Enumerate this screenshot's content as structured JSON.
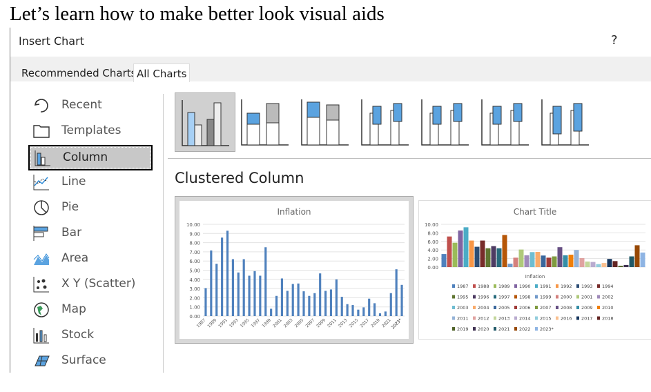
{
  "slide": {
    "title": "Let’s learn how to make better look visual aids"
  },
  "dialog": {
    "title": "Insert Chart",
    "help": "?",
    "tabs": [
      {
        "label": "Recommended Charts"
      },
      {
        "label": "All Charts"
      }
    ],
    "nav": [
      {
        "label": "Recent",
        "icon": "recent-icon"
      },
      {
        "label": "Templates",
        "icon": "folder-icon"
      },
      {
        "label": "Column",
        "icon": "column-chart-icon",
        "selected": true
      },
      {
        "label": "Line",
        "icon": "line-chart-icon"
      },
      {
        "label": "Pie",
        "icon": "pie-chart-icon"
      },
      {
        "label": "Bar",
        "icon": "bar-chart-icon"
      },
      {
        "label": "Area",
        "icon": "area-chart-icon"
      },
      {
        "label": "X Y (Scatter)",
        "icon": "scatter-chart-icon"
      },
      {
        "label": "Map",
        "icon": "map-icon"
      },
      {
        "label": "Stock",
        "icon": "stock-chart-icon"
      },
      {
        "label": "Surface",
        "icon": "surface-chart-icon"
      }
    ],
    "chart_types": [
      "clustered-column",
      "stacked-column",
      "100-stacked-column",
      "3d-clustered-column",
      "3d-stacked-column",
      "3d-100-stacked-column",
      "3d-column"
    ],
    "selected_type_label": "Clustered Column"
  },
  "chart_data": [
    {
      "type": "bar",
      "title": "Inflation",
      "xlabel": "",
      "ylabel": "",
      "ylim": [
        0,
        10
      ],
      "yticks": [
        "0.00",
        "1.00",
        "2.00",
        "3.00",
        "4.00",
        "5.00",
        "6.00",
        "7.00",
        "8.00",
        "9.00",
        "10.00"
      ],
      "grid": true,
      "color": "#4f81bd",
      "categories": [
        "1987",
        "1988",
        "1989",
        "1990",
        "1991",
        "1992",
        "1993",
        "1994",
        "1995",
        "1996",
        "1997",
        "1998",
        "1999",
        "2000",
        "2001",
        "2002",
        "2003",
        "2004",
        "2005",
        "2006",
        "2007",
        "2008",
        "2009",
        "2010",
        "2011",
        "2012",
        "2013",
        "2014",
        "2015",
        "2016",
        "2017",
        "2018",
        "2019",
        "2020",
        "2021",
        "2022",
        "2023*"
      ],
      "values": [
        3.05,
        7.15,
        5.7,
        8.55,
        9.3,
        6.2,
        4.75,
        6.2,
        4.4,
        4.9,
        4.4,
        7.5,
        0.8,
        2.2,
        4.1,
        2.75,
        3.5,
        3.55,
        2.7,
        2.2,
        2.5,
        4.65,
        2.75,
        2.9,
        4.0,
        2.1,
        1.3,
        1.2,
        0.7,
        0.95,
        1.9,
        1.4,
        0.3,
        0.5,
        2.5,
        5.1,
        3.4
      ]
    },
    {
      "type": "bar",
      "title": "Chart Title",
      "xlabel": "Inflation",
      "ylim": [
        0,
        10
      ],
      "yticks": [
        "0.00",
        "2.00",
        "4.00",
        "6.00",
        "8.00",
        "10.00"
      ],
      "grid": true,
      "legend": "bottom",
      "series_from": "categories of first chart",
      "palette": [
        "#4f81bd",
        "#c0504d",
        "#9bbb59",
        "#8064a2",
        "#4bacc6",
        "#f79646",
        "#2c4d75",
        "#772c2a",
        "#5f7530",
        "#4d3b62",
        "#276a7c",
        "#b65708",
        "#729aca",
        "#d4807d",
        "#afc97a",
        "#a08bba",
        "#6fbdd1",
        "#f9ab6b",
        "#3a679c",
        "#9f3b38",
        "#7f9b40",
        "#664f83",
        "#358ea6",
        "#f07f09",
        "#95b3d7",
        "#e0a3a1",
        "#c3d69b",
        "#b9abcf",
        "#92cddc",
        "#fac08f",
        "#17375e",
        "#632523",
        "#4f6228",
        "#3f3151",
        "#215968",
        "#974806",
        "#8eb4e3"
      ]
    }
  ]
}
